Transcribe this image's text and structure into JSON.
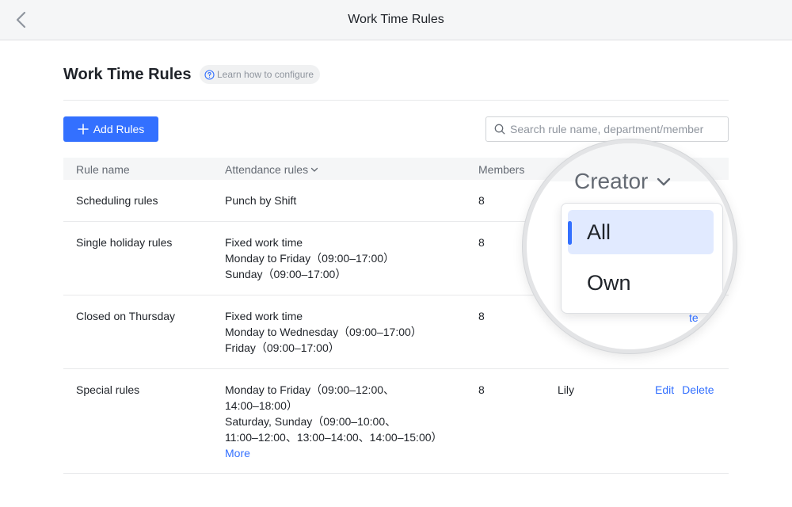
{
  "topbar": {
    "title": "Work Time Rules"
  },
  "header": {
    "title": "Work Time Rules",
    "help_link": "Learn how to configure"
  },
  "toolbar": {
    "add_label": "Add Rules",
    "search_placeholder": "Search rule name, department/member"
  },
  "table": {
    "columns": {
      "name": "Rule name",
      "attendance": "Attendance rules",
      "members": "Members",
      "creator": "Creator"
    },
    "rows": [
      {
        "name": "Scheduling rules",
        "attendance": [
          "Punch by Shift"
        ],
        "members": "8",
        "creator": "",
        "more": ""
      },
      {
        "name": "Single holiday rules",
        "attendance": [
          "Fixed work time",
          "Monday to Friday（09:00–17:00）",
          "Sunday（09:00–17:00）"
        ],
        "members": "8",
        "creator": "",
        "more": ""
      },
      {
        "name": "Closed on Thursday",
        "attendance": [
          "Fixed work time",
          "Monday to Wednesday（09:00–17:00）",
          "Friday（09:00–17:00）"
        ],
        "members": "8",
        "creator": "",
        "more": ""
      },
      {
        "name": "Special rules",
        "attendance": [
          "Monday to Friday（09:00–12:00、",
          "14:00–18:00）",
          "Saturday, Sunday（09:00–10:00、",
          "11:00–12:00、13:00–14:00、14:00–15:00）"
        ],
        "members": "8",
        "creator": "Lily",
        "more": "More"
      }
    ],
    "actions": {
      "edit": "Edit",
      "delete": "Delete",
      "delete_partial": "te"
    }
  },
  "creator_filter": {
    "label": "Creator",
    "options": [
      {
        "label": "All",
        "selected": true
      },
      {
        "label": "Own",
        "selected": false
      }
    ]
  },
  "icons": {
    "back": "chevron-left-icon",
    "help": "question-circle-icon",
    "add": "plus-icon",
    "search": "search-icon",
    "dropdown": "chevron-down-icon"
  },
  "colors": {
    "accent": "#3370ff",
    "selected_bg": "#e1eaff",
    "header_bg": "#f5f6f7"
  }
}
